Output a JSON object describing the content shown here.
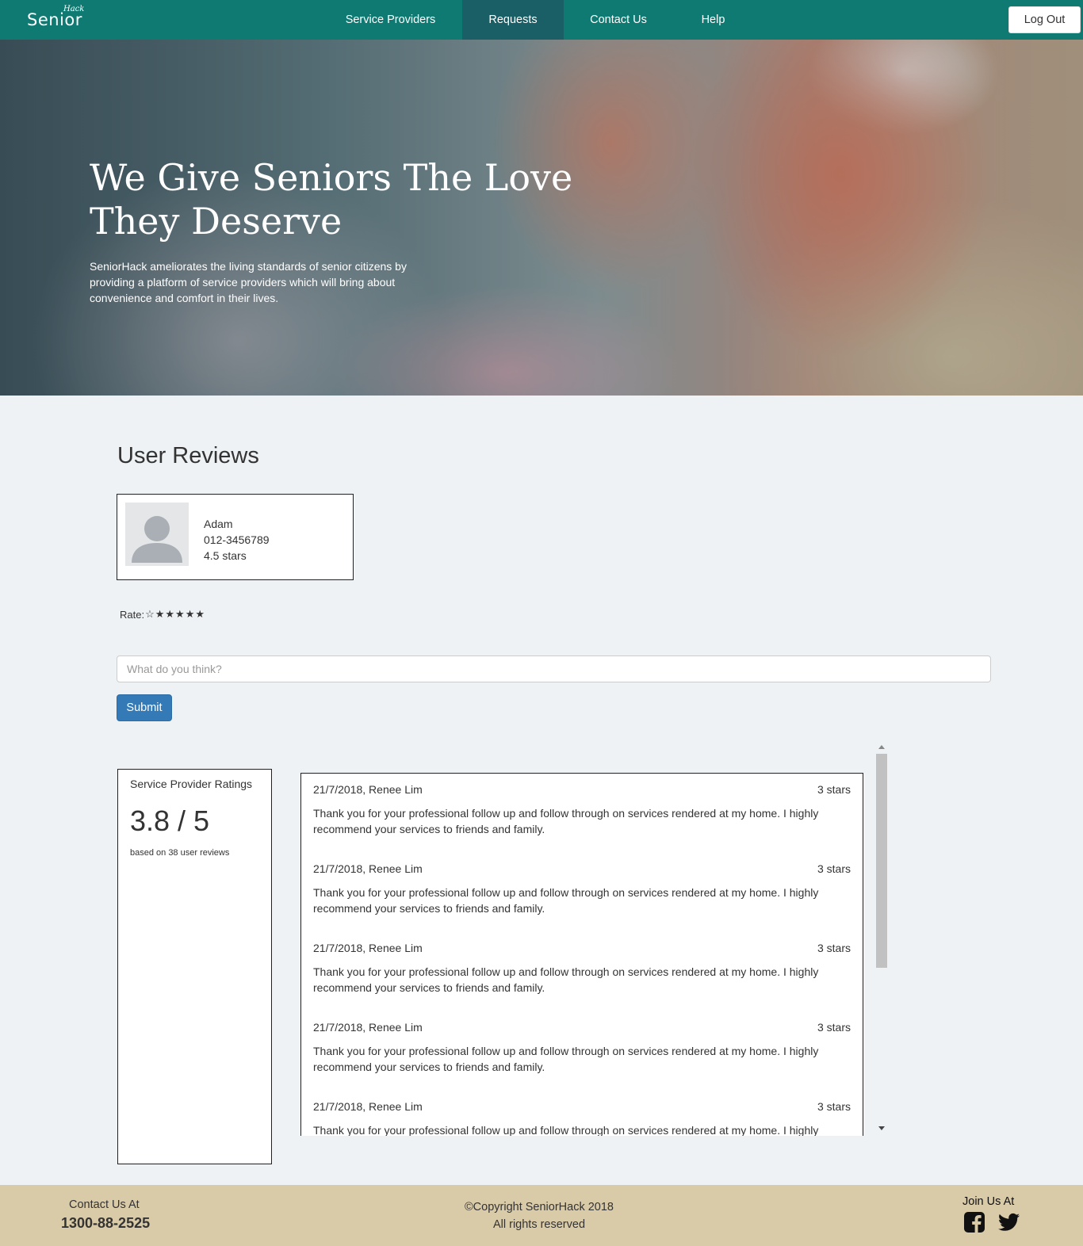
{
  "nav": {
    "logo_main": "Senior",
    "logo_sup": "Hack",
    "items": [
      {
        "label": "Service Providers"
      },
      {
        "label": "Requests"
      },
      {
        "label": "Contact Us"
      },
      {
        "label": "Help"
      }
    ],
    "active": "Requests",
    "logout_label": "Log Out"
  },
  "hero": {
    "title": "We Give Seniors The Love They Deserve",
    "text": "SeniorHack ameliorates the living standards of senior citizens by providing a platform of service providers which will bring about convenience and comfort in their lives."
  },
  "reviews_section": {
    "title": "User Reviews",
    "user": {
      "name": "Adam",
      "phone": "012-3456789",
      "rating": "4.5 stars"
    },
    "rate_label": "Rate:",
    "stars": [
      "☆",
      "★",
      "★",
      "★",
      "★",
      "★"
    ],
    "comment_placeholder": "What do you think?",
    "submit_label": "Submit"
  },
  "ratings": {
    "title": "Service Provider Ratings",
    "score": "3.8 / 5",
    "note": "based on 38 user reviews"
  },
  "reviews": [
    {
      "meta": "21/7/2018, Renee Lim",
      "stars": "3 stars",
      "text": "Thank you for your professional follow up and follow through on services rendered at my home. I highly recommend your services to friends and family."
    },
    {
      "meta": "21/7/2018, Renee Lim",
      "stars": "3 stars",
      "text": "Thank you for your professional follow up and follow through on services rendered at my home. I highly recommend your services to friends and family."
    },
    {
      "meta": "21/7/2018, Renee Lim",
      "stars": "3 stars",
      "text": "Thank you for your professional follow up and follow through on services rendered at my home. I highly recommend your services to friends and family."
    },
    {
      "meta": "21/7/2018, Renee Lim",
      "stars": "3 stars",
      "text": "Thank you for your professional follow up and follow through on services rendered at my home. I highly recommend your services to friends and family."
    },
    {
      "meta": "21/7/2018, Renee Lim",
      "stars": "3 stars",
      "text": "Thank you for your professional follow up and follow through on services rendered at my home. I highly recommend your services to friends and family."
    }
  ],
  "footer": {
    "contact_label": "Contact Us At",
    "phone": "1300-88-2525",
    "copyright": "©Copyright SeniorHack 2018",
    "rights": "All rights reserved",
    "join_label": "Join Us At",
    "social_icons": [
      "facebook-icon",
      "twitter-icon"
    ]
  },
  "colors": {
    "nav_bg": "#0e7a72",
    "nav_active": "#1a5f66",
    "submit_bg": "#337ab7",
    "footer_bg": "#d9caa8",
    "page_bg": "#eef2f4"
  }
}
